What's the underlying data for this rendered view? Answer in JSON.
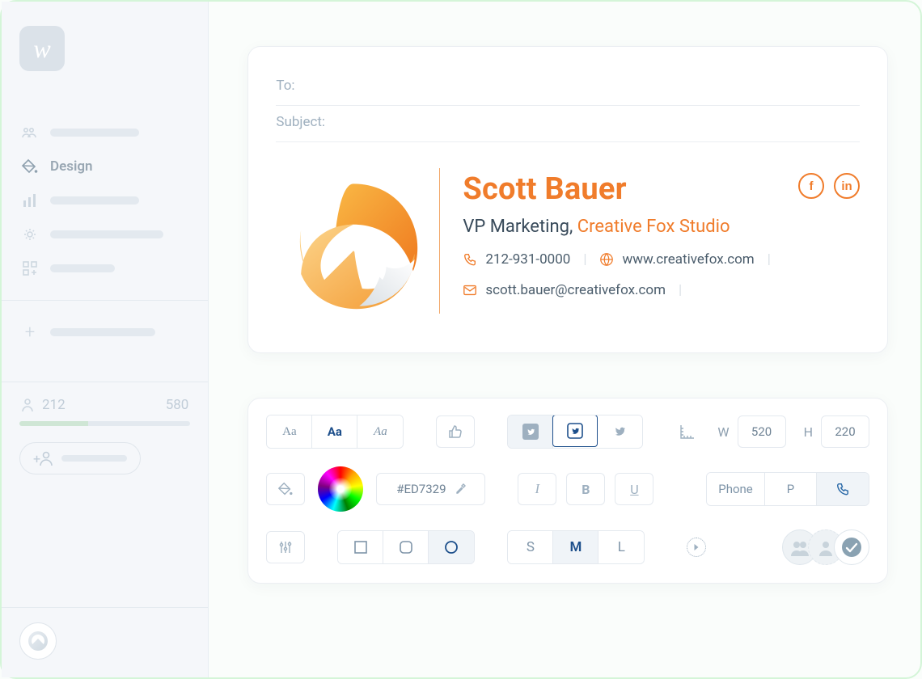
{
  "app": {
    "logo_letter": "w"
  },
  "sidebar": {
    "items": [
      {
        "icon": "people",
        "label": ""
      },
      {
        "icon": "paint",
        "label": "Design"
      },
      {
        "icon": "chart",
        "label": ""
      },
      {
        "icon": "sparkle",
        "label": ""
      },
      {
        "icon": "grid-plus",
        "label": ""
      }
    ],
    "add_icon": "plus",
    "counts": {
      "current": "212",
      "max": "580"
    },
    "add_user_icon": "user-plus"
  },
  "email": {
    "to_label": "To:",
    "subject_label": "Subject:"
  },
  "signature": {
    "name": "Scott Bauer",
    "title": "VP Marketing,",
    "company": "Creative Fox Studio",
    "phone": "212-931-0000",
    "website": "www.creativefox.com",
    "email": "scott.bauer@creativefox.com",
    "socials": [
      {
        "name": "facebook",
        "glyph": "f"
      },
      {
        "name": "linkedin",
        "glyph": "in"
      }
    ],
    "color_accent": "#f07c2b"
  },
  "toolbar": {
    "font_options": [
      "Aa",
      "Aa",
      "Aa"
    ],
    "font_selected_index": 1,
    "like_icon": "thumbs-up",
    "social_icons": [
      "twitter",
      "twitter",
      "twitter"
    ],
    "social_selected_index": 1,
    "ruler_icon": "ruler",
    "width_label": "W",
    "width_value": "520",
    "height_label": "H",
    "height_value": "220",
    "paint_icon": "paint-bucket",
    "color_value": "#ED7329",
    "eyedropper_icon": "eyedropper",
    "italic": "I",
    "bold": "B",
    "underline": "U",
    "phone_text_label": "Phone",
    "phone_letter_label": "P",
    "phone_icon": "phone",
    "phone_selected_index": 2,
    "slider_icon": "sliders",
    "shapes": [
      "square",
      "rounded-square",
      "circle"
    ],
    "shape_selected_index": 2,
    "sizes": [
      "S",
      "M",
      "L"
    ],
    "size_selected_index": 1,
    "playhead_icon": "playhead"
  }
}
